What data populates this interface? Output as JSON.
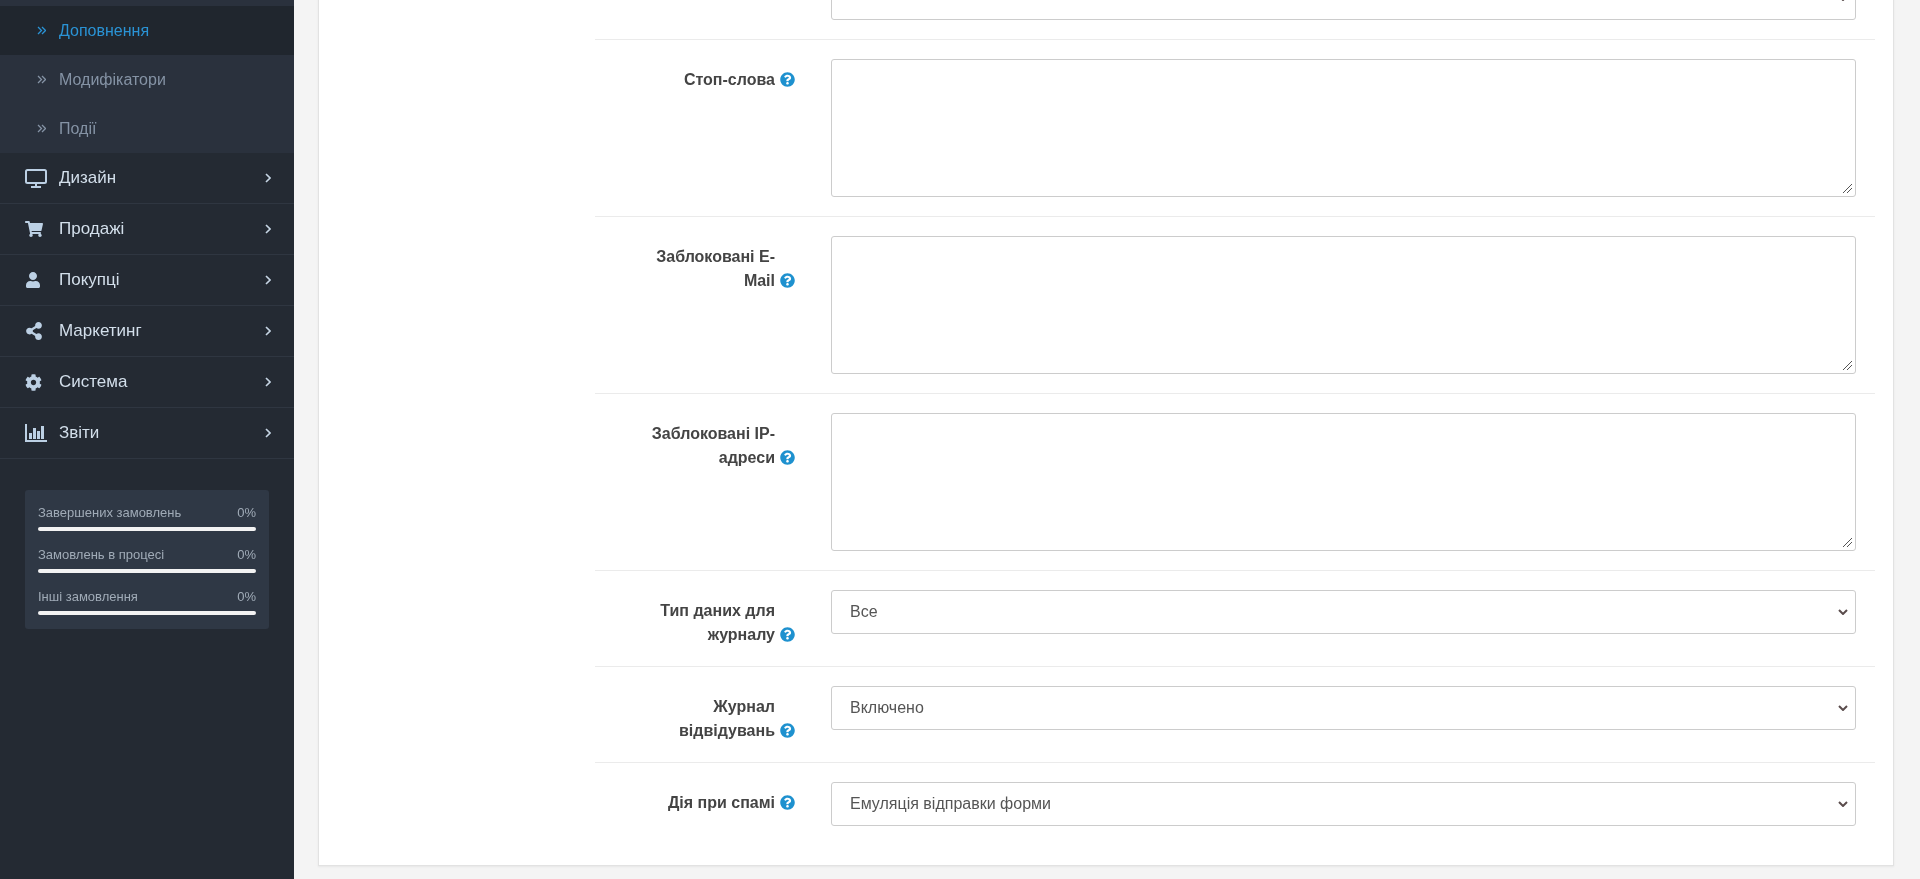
{
  "sidebar": {
    "submenu": [
      {
        "label": "Доповнення",
        "selected": true
      },
      {
        "label": "Модифікатори",
        "selected": false
      },
      {
        "label": "Події",
        "selected": false
      }
    ],
    "menu": [
      {
        "label": "Дизайн"
      },
      {
        "label": "Продажі"
      },
      {
        "label": "Покупці"
      },
      {
        "label": "Маркетинг"
      },
      {
        "label": "Система"
      },
      {
        "label": "Звіти"
      }
    ],
    "stats": [
      {
        "label": "Завершених замовлень",
        "reading": "0%",
        "level": 0
      },
      {
        "label": "Замовлень в процесі",
        "reading": "0%",
        "level": 0
      },
      {
        "label": "Інші замовлення",
        "reading": "0%",
        "level": 0
      }
    ]
  },
  "form": {
    "fields": [
      {
        "kind": "select"
      },
      {
        "label": "Стоп-слова",
        "kind": "textarea"
      },
      {
        "label": "Заблоковані E-Mail",
        "kind": "textarea"
      },
      {
        "label": "Заблоковані IP-адреси",
        "kind": "textarea"
      },
      {
        "label": "Тип даних для журналу",
        "kind": "select",
        "value": "Все"
      },
      {
        "label": "Журнал відвідувань",
        "kind": "select",
        "value": "Включено"
      },
      {
        "label": "Дія при спамі",
        "kind": "select",
        "value": "Емуляція відправки форми"
      }
    ]
  }
}
